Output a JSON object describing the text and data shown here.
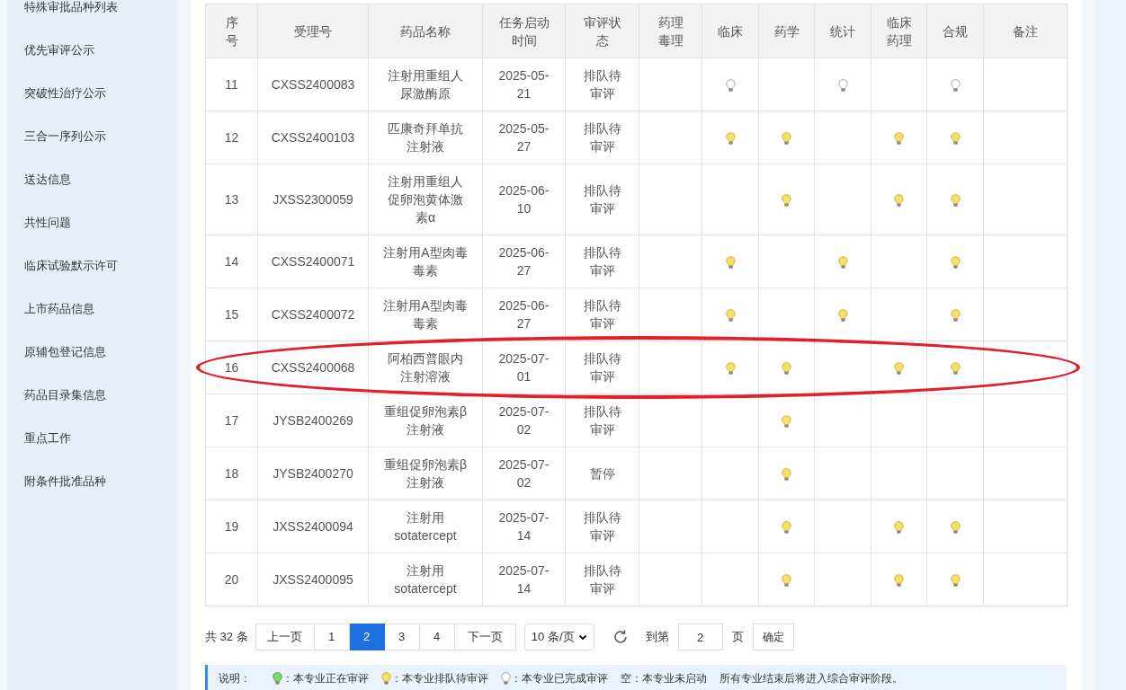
{
  "sidebar": {
    "items": [
      {
        "label": "特殊审批品种列表"
      },
      {
        "label": "优先审评公示"
      },
      {
        "label": "突破性治疗公示"
      },
      {
        "label": "三合一序列公示"
      },
      {
        "label": "送达信息"
      },
      {
        "label": "共性问题"
      },
      {
        "label": "临床试验默示许可"
      },
      {
        "label": "上市药品信息"
      },
      {
        "label": "原辅包登记信息"
      },
      {
        "label": "药品目录集信息"
      },
      {
        "label": "重点工作"
      },
      {
        "label": "附条件批准品种"
      }
    ]
  },
  "table": {
    "columns": [
      "序号",
      "受理号",
      "药品名称",
      "任务启动时间",
      "审评状态",
      "药理毒理",
      "临床",
      "药学",
      "统计",
      "临床药理",
      "合规",
      "备注"
    ],
    "rows": [
      {
        "no": "11",
        "accept_no": "CXSS2400083",
        "drug": "注射用重组人尿激酶原",
        "start": "2025-05-21",
        "status": "排队待审评",
        "circled": false,
        "reviews": [
          {
            "kind": "none"
          },
          {
            "kind": "done"
          },
          {
            "kind": "none"
          },
          {
            "kind": "done"
          },
          {
            "kind": "none"
          },
          {
            "kind": "done"
          }
        ]
      },
      {
        "no": "12",
        "accept_no": "CXSS2400103",
        "drug": "匹康奇拜单抗注射液",
        "start": "2025-05-27",
        "status": "排队待审评",
        "circled": false,
        "reviews": [
          {
            "kind": "none"
          },
          {
            "kind": "queued"
          },
          {
            "kind": "queued"
          },
          {
            "kind": "none"
          },
          {
            "kind": "queued"
          },
          {
            "kind": "queued"
          }
        ]
      },
      {
        "no": "13",
        "accept_no": "JXSS2300059",
        "drug": "注射用重组人促卵泡黄体激素α",
        "start": "2025-06-10",
        "status": "排队待审评",
        "circled": false,
        "reviews": [
          {
            "kind": "none"
          },
          {
            "kind": "none"
          },
          {
            "kind": "queued"
          },
          {
            "kind": "none"
          },
          {
            "kind": "queued"
          },
          {
            "kind": "queued"
          }
        ]
      },
      {
        "no": "14",
        "accept_no": "CXSS2400071",
        "drug": "注射用A型肉毒毒素",
        "start": "2025-06-27",
        "status": "排队待审评",
        "circled": false,
        "reviews": [
          {
            "kind": "none"
          },
          {
            "kind": "queued"
          },
          {
            "kind": "none"
          },
          {
            "kind": "queued"
          },
          {
            "kind": "none"
          },
          {
            "kind": "queued"
          }
        ]
      },
      {
        "no": "15",
        "accept_no": "CXSS2400072",
        "drug": "注射用A型肉毒毒素",
        "start": "2025-06-27",
        "status": "排队待审评",
        "circled": false,
        "reviews": [
          {
            "kind": "none"
          },
          {
            "kind": "queued"
          },
          {
            "kind": "none"
          },
          {
            "kind": "queued"
          },
          {
            "kind": "none"
          },
          {
            "kind": "queued"
          }
        ]
      },
      {
        "no": "16",
        "accept_no": "CXSS2400068",
        "drug": "阿柏西普眼内注射溶液",
        "start": "2025-07-01",
        "status": "排队待审评",
        "circled": true,
        "reviews": [
          {
            "kind": "none"
          },
          {
            "kind": "queued"
          },
          {
            "kind": "queued"
          },
          {
            "kind": "none"
          },
          {
            "kind": "queued"
          },
          {
            "kind": "queued"
          }
        ]
      },
      {
        "no": "17",
        "accept_no": "JYSB2400269",
        "drug": "重组促卵泡素β注射液",
        "start": "2025-07-02",
        "status": "排队待审评",
        "circled": false,
        "reviews": [
          {
            "kind": "none"
          },
          {
            "kind": "none"
          },
          {
            "kind": "queued"
          },
          {
            "kind": "none"
          },
          {
            "kind": "none"
          },
          {
            "kind": "none"
          }
        ]
      },
      {
        "no": "18",
        "accept_no": "JYSB2400270",
        "drug": "重组促卵泡素β注射液",
        "start": "2025-07-02",
        "status": "暂停",
        "circled": false,
        "reviews": [
          {
            "kind": "none"
          },
          {
            "kind": "none"
          },
          {
            "kind": "queued"
          },
          {
            "kind": "none"
          },
          {
            "kind": "none"
          },
          {
            "kind": "none"
          }
        ]
      },
      {
        "no": "19",
        "accept_no": "JXSS2400094",
        "drug": "注射用sotatercept",
        "start": "2025-07-14",
        "status": "排队待审评",
        "circled": false,
        "reviews": [
          {
            "kind": "none"
          },
          {
            "kind": "none"
          },
          {
            "kind": "queued"
          },
          {
            "kind": "none"
          },
          {
            "kind": "queued"
          },
          {
            "kind": "queued"
          }
        ]
      },
      {
        "no": "20",
        "accept_no": "JXSS2400095",
        "drug": "注射用sotatercept",
        "start": "2025-07-14",
        "status": "排队待审评",
        "circled": false,
        "reviews": [
          {
            "kind": "none"
          },
          {
            "kind": "none"
          },
          {
            "kind": "queued"
          },
          {
            "kind": "none"
          },
          {
            "kind": "queued"
          },
          {
            "kind": "queued"
          }
        ]
      }
    ]
  },
  "pagination": {
    "total": "共 32 条",
    "prev": "上一页",
    "pages": [
      {
        "label": "1",
        "selected": false
      },
      {
        "label": "2",
        "selected": true
      },
      {
        "label": "3",
        "selected": false
      },
      {
        "label": "4",
        "selected": false
      }
    ],
    "next": "下一页",
    "page_size": "10 条/页",
    "goto_label": "到第",
    "goto_value": "2",
    "page_unit": "页",
    "confirm": "确定"
  },
  "legend": {
    "title": "说明：",
    "items": [
      {
        "kind": "active",
        "text": "：本专业正在审评"
      },
      {
        "kind": "queued",
        "text": "：本专业排队待审评"
      },
      {
        "kind": "done",
        "text": "：本专业已完成审评"
      }
    ],
    "empty_note": "空：本专业未启动",
    "final_note": "所有专业结束后将进入综合审评阶段。"
  }
}
